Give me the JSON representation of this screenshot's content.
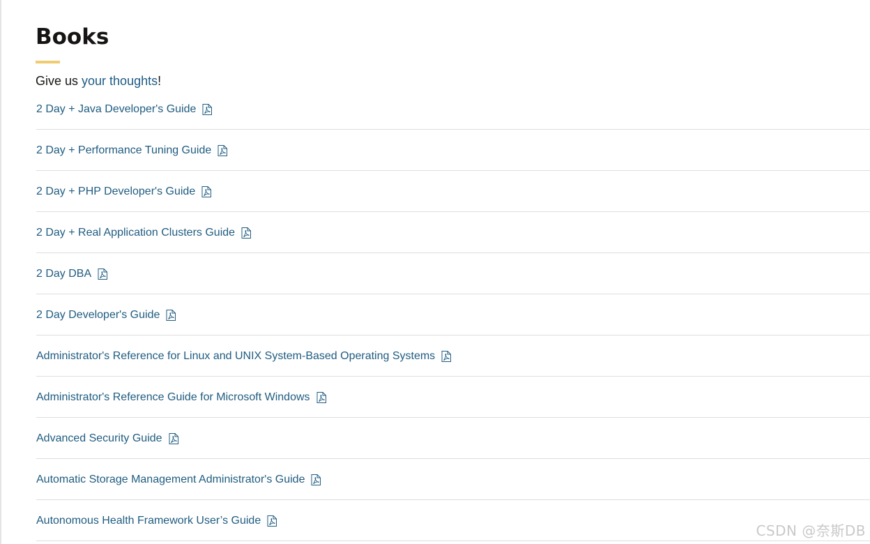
{
  "header": {
    "title": "Books"
  },
  "feedback": {
    "prefix": "Give us ",
    "link_text": "your thoughts",
    "suffix": "!"
  },
  "books": [
    {
      "label": "2 Day + Java Developer's Guide",
      "icon": "pdf-icon"
    },
    {
      "label": "2 Day + Performance Tuning Guide",
      "icon": "pdf-icon"
    },
    {
      "label": "2 Day + PHP Developer's Guide",
      "icon": "pdf-icon"
    },
    {
      "label": "2 Day + Real Application Clusters Guide",
      "icon": "pdf-icon"
    },
    {
      "label": "2 Day DBA",
      "icon": "pdf-icon"
    },
    {
      "label": "2 Day Developer's Guide",
      "icon": "pdf-icon"
    },
    {
      "label": "Administrator's Reference for Linux and UNIX System-Based Operating Systems",
      "icon": "pdf-icon"
    },
    {
      "label": "Administrator's Reference Guide for Microsoft Windows",
      "icon": "pdf-icon"
    },
    {
      "label": "Advanced Security Guide",
      "icon": "pdf-icon"
    },
    {
      "label": "Automatic Storage Management Administrator's Guide",
      "icon": "pdf-icon"
    },
    {
      "label": "Autonomous Health Framework User’s Guide",
      "icon": "pdf-icon"
    }
  ],
  "watermark": "CSDN @奈斯DB",
  "colors": {
    "link": "#1f5c80",
    "accent_underline": "#f0cc71",
    "divider": "#dedede",
    "title_text": "#161513"
  }
}
